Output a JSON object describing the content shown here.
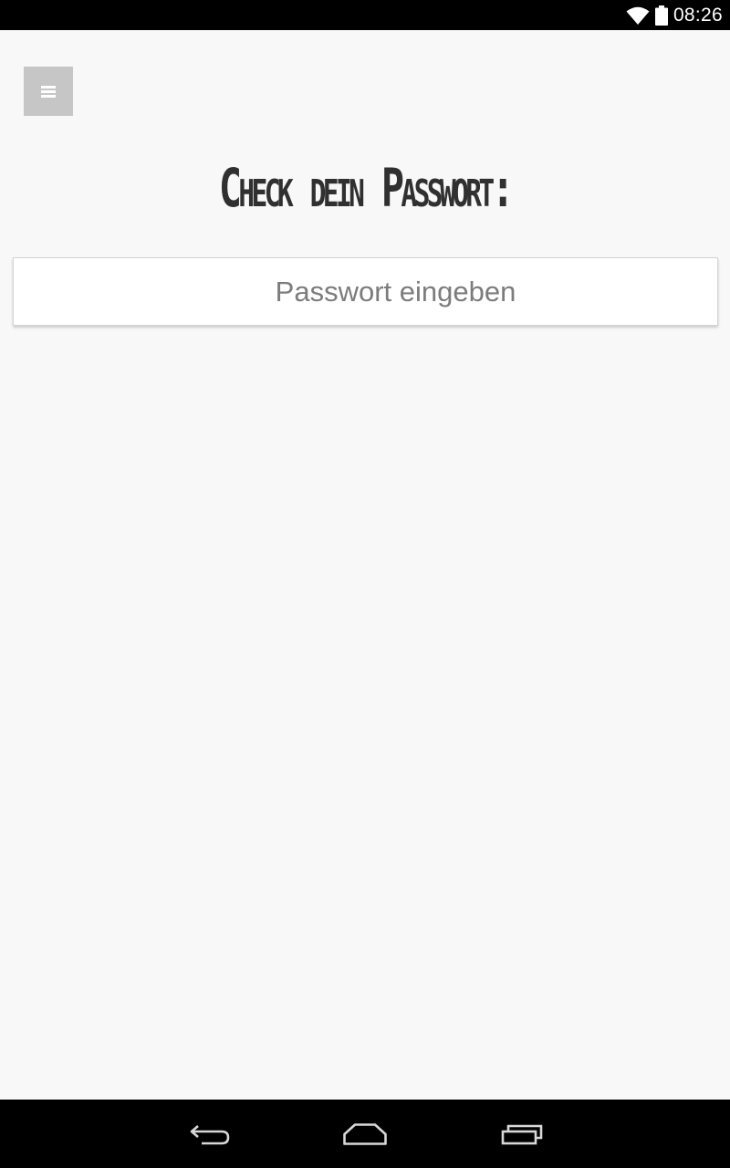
{
  "status_bar": {
    "time": "08:26",
    "icons": [
      "wifi-icon",
      "battery-icon"
    ]
  },
  "header": {
    "menu_icon": "hamburger-menu-icon"
  },
  "main": {
    "title": "Check dein Passwort:",
    "password_input": {
      "value": "",
      "placeholder": "Passwort eingeben"
    }
  },
  "nav_bar": {
    "buttons": [
      "back-icon",
      "home-icon",
      "recent-apps-icon"
    ]
  },
  "colors": {
    "background": "#f8f8f8",
    "status_bar": "#000000",
    "menu_button": "#c6c6c6",
    "title_text": "#303030",
    "placeholder_text": "#7c7c7c"
  }
}
